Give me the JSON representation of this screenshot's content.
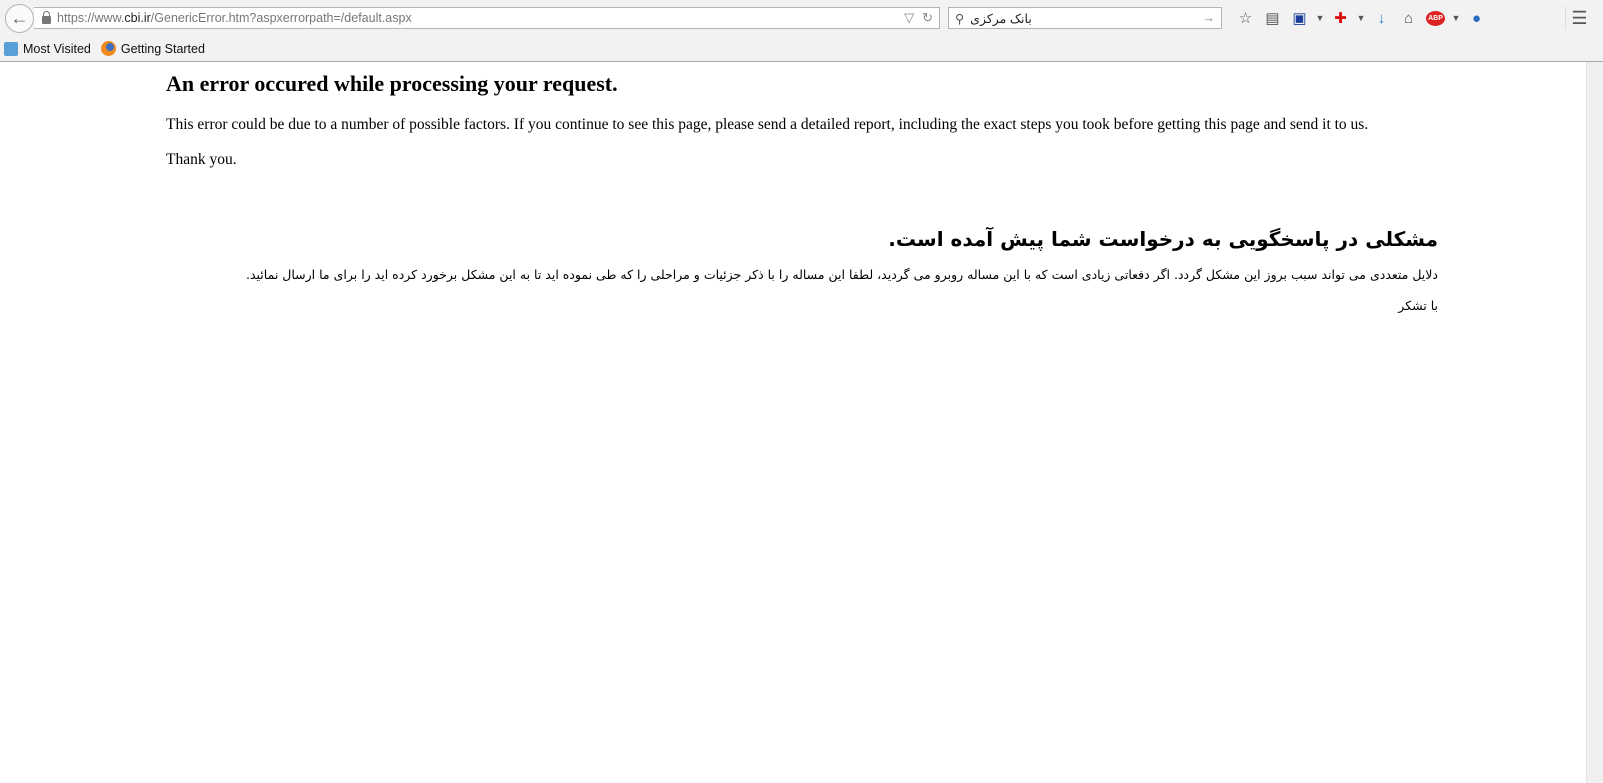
{
  "browser": {
    "url_prefix": "https://www.",
    "url_host": "cbi.ir",
    "url_path": "/GenericError.htm?aspxerrorpath=/default.aspx",
    "search_value": "بانک مرکزی",
    "bookmarks": [
      "Most Visited",
      "Getting Started"
    ],
    "toolbar_icons": [
      "bookmark-star-icon",
      "reading-list-icon",
      "save-icon",
      "addon-icon",
      "download-icon",
      "home-icon",
      "adblock-plus-icon",
      "addon-user-icon"
    ],
    "adblock_label": "ABP"
  },
  "page": {
    "title_en": "An error occured while processing your request.",
    "body_en": "This error could be due to a number of possible factors. If you continue to see this page, please send a detailed report, including the exact steps you took before getting this page and send it to us.",
    "thanks_en": "Thank you.",
    "title_fa": "مشکلی در پاسخگویی به درخواست شما پیش آمده است.",
    "body_fa": "دلایل متعددی می تواند سبب بروز این مشکل گردد. اگر دفعاتی زیادی است که با این مساله روبرو می گردید، لطفا این مساله را با ذکر جزئیات و مراحلی را که طی نموده اید تا به این مشکل برخورد کرده اید را برای ما ارسال نمائید.",
    "thanks_fa": "با تشکر"
  }
}
